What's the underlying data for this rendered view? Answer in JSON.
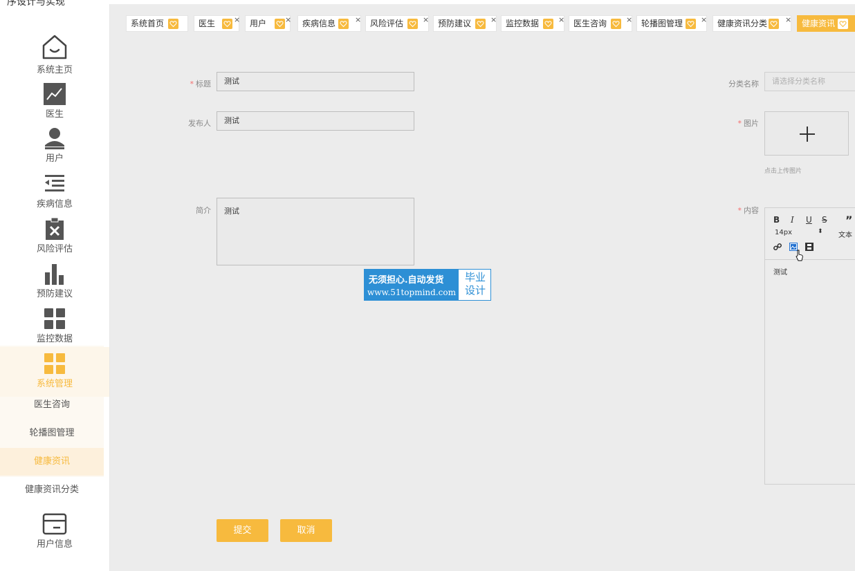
{
  "app": {
    "title": "序设计与实现"
  },
  "sidebar": {
    "items": [
      {
        "label": "系统主页",
        "icon": "home-icon"
      },
      {
        "label": "医生",
        "icon": "chart-icon"
      },
      {
        "label": "用户",
        "icon": "user-icon"
      },
      {
        "label": "疾病信息",
        "icon": "list-icon"
      },
      {
        "label": "风险评估",
        "icon": "clipboard-x-icon"
      },
      {
        "label": "预防建议",
        "icon": "bar-chart-icon"
      },
      {
        "label": "监控数据",
        "icon": "grid-icon"
      },
      {
        "label": "系统管理",
        "icon": "grid-icon"
      }
    ],
    "sub_items": [
      {
        "label": "医生咨询"
      },
      {
        "label": "轮播图管理"
      },
      {
        "label": "健康资讯"
      },
      {
        "label": "健康资讯分类"
      }
    ],
    "user_info": {
      "label": "用户信息",
      "icon": "card-icon"
    }
  },
  "tabs": [
    {
      "label": "系统首页"
    },
    {
      "label": "医生"
    },
    {
      "label": "用户"
    },
    {
      "label": "疾病信息"
    },
    {
      "label": "风险评估"
    },
    {
      "label": "预防建议"
    },
    {
      "label": "监控数据"
    },
    {
      "label": "医生咨询"
    },
    {
      "label": "轮播图管理"
    },
    {
      "label": "健康资讯分类"
    },
    {
      "label": "健康资讯"
    }
  ],
  "form": {
    "title": {
      "label": "标题",
      "value": "测试"
    },
    "category": {
      "label": "分类名称",
      "placeholder": "请选择分类名称"
    },
    "publisher": {
      "label": "发布人",
      "value": "测试"
    },
    "image": {
      "label": "图片",
      "hint": "点击上传图片"
    },
    "summary": {
      "label": "简介",
      "value": "测试"
    },
    "content": {
      "label": "内容",
      "value": "测试",
      "font_size": "14px",
      "text_label": "文本",
      "toolbar": [
        "B",
        "I",
        "U",
        "S",
        "”"
      ]
    },
    "submit": "提交",
    "cancel": "取消"
  },
  "watermark": {
    "line1": "无须担心.自动发货",
    "line2": "www.51topmind.com",
    "right1": "毕业",
    "right2": "设计"
  },
  "colors": {
    "accent": "#f7ba3e",
    "required": "#f56c6c",
    "watermark": "#2d8fd5"
  }
}
